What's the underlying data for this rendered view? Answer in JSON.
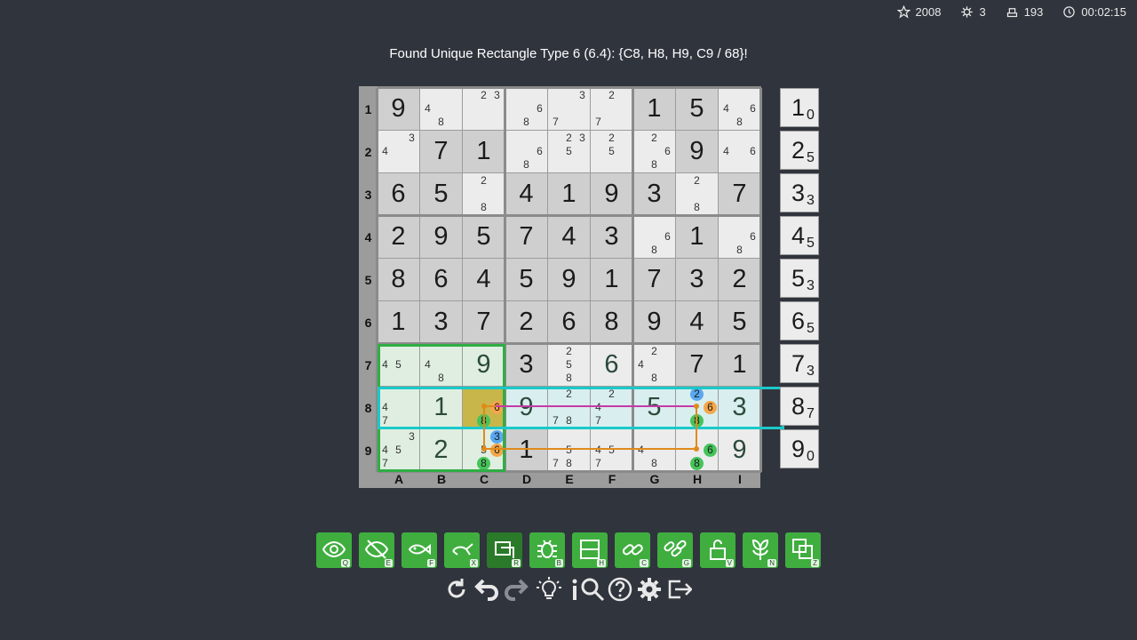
{
  "stats": [
    {
      "icon": "star-icon",
      "value": "2008"
    },
    {
      "icon": "bug-icon",
      "value": "3"
    },
    {
      "icon": "eraser-icon",
      "value": "193"
    },
    {
      "icon": "clock-icon",
      "value": "00:02:15"
    }
  ],
  "message": "Found Unique Rectangle Type 6 (6.4): {C8, H8, H9, C9 / 68}!",
  "row_labels": [
    "1",
    "2",
    "3",
    "4",
    "5",
    "6",
    "7",
    "8",
    "9"
  ],
  "col_labels": [
    "A",
    "B",
    "C",
    "D",
    "E",
    "F",
    "G",
    "H",
    "I"
  ],
  "cells": [
    [
      "9g",
      "48",
      "23",
      "68",
      "37",
      "27",
      "1g",
      "5g",
      "468"
    ],
    [
      "34",
      "7g",
      "1g",
      "68",
      "235",
      "25",
      "268",
      "9g",
      "46"
    ],
    [
      "6g",
      "5g",
      "28",
      "4g",
      "1g",
      "9g",
      "3g",
      "28",
      "7g"
    ],
    [
      "2g",
      "9g",
      "5g",
      "7g",
      "4g",
      "3g",
      "68",
      "1g",
      "68"
    ],
    [
      "8g",
      "6g",
      "4g",
      "5g",
      "9g",
      "1g",
      "7g",
      "3g",
      "2g"
    ],
    [
      "1g",
      "3g",
      "7g",
      "2g",
      "6g",
      "8g",
      "9g",
      "4g",
      "5g"
    ],
    [
      "45",
      "48",
      "9",
      "3g",
      "258",
      "6",
      "248",
      "7g",
      "1g"
    ],
    [
      "47",
      "1",
      "68",
      "9",
      "278",
      "247",
      "5",
      "268",
      "3"
    ],
    [
      "3457",
      "2",
      "3568",
      "1g",
      "578",
      "457",
      "48",
      "68",
      "9"
    ]
  ],
  "counters": [
    {
      "digit": "1",
      "count": "0"
    },
    {
      "digit": "2",
      "count": "5"
    },
    {
      "digit": "3",
      "count": "3"
    },
    {
      "digit": "4",
      "count": "5"
    },
    {
      "digit": "5",
      "count": "3"
    },
    {
      "digit": "6",
      "count": "5"
    },
    {
      "digit": "7",
      "count": "3"
    },
    {
      "digit": "8",
      "count": "7"
    },
    {
      "digit": "9",
      "count": "0"
    }
  ],
  "toolbar": [
    {
      "name": "eye",
      "key": "Q"
    },
    {
      "name": "eye-off",
      "key": "E"
    },
    {
      "name": "fish",
      "key": "F"
    },
    {
      "name": "swordfish",
      "key": "X"
    },
    {
      "name": "rectangle",
      "key": "R"
    },
    {
      "name": "bug",
      "key": "B"
    },
    {
      "name": "house",
      "key": "H"
    },
    {
      "name": "chain",
      "key": "C"
    },
    {
      "name": "chain-group",
      "key": "G"
    },
    {
      "name": "lock",
      "key": "V"
    },
    {
      "name": "flower",
      "key": "N"
    },
    {
      "name": "layers",
      "key": "Z"
    }
  ],
  "bottom_icons": [
    "restart",
    "undo",
    "redo",
    "hint",
    "info",
    "search",
    "help",
    "settings",
    "exit"
  ],
  "colors": {
    "background": "#30343d",
    "given_cell": "#cfcfcf",
    "empty_cell": "#ececec",
    "box_highlight": "#2fae44",
    "row_highlight": "#1ac9c9",
    "link_orange": "#e08a1c",
    "link_magenta": "#c63aa8",
    "cand_orange": "#f4a64a",
    "cand_green": "#46c45a",
    "cand_blue": "#5aa8f0",
    "toolbar_green": "#3fae3f"
  }
}
